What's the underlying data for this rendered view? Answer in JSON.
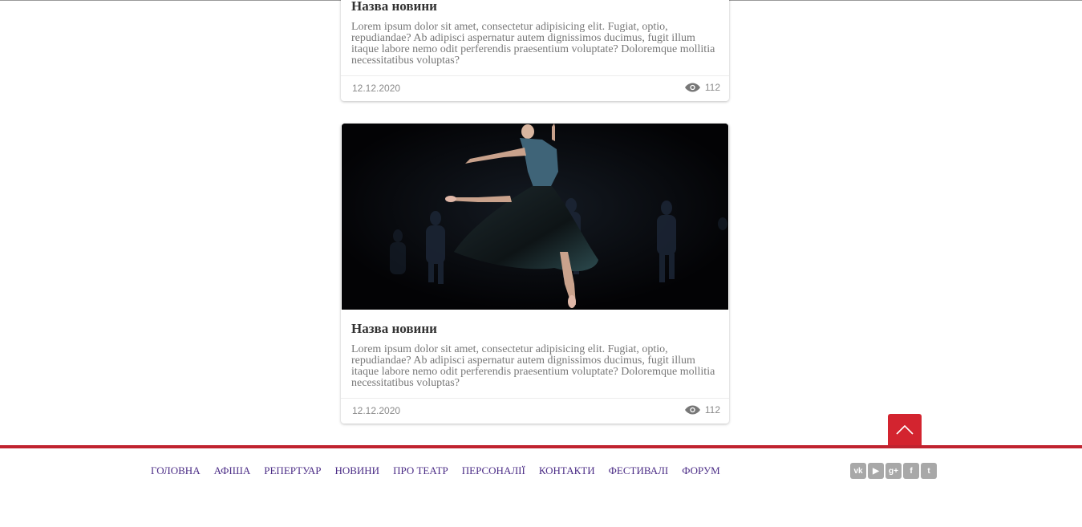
{
  "news": [
    {
      "title": "Назва новини",
      "text_lines": [
        "Lorem ipsum dolor sit amet, consectetur adipisicing elit. Fugiat, optio,",
        "repudiandae? Ab adipisci aspernatur autem dignissimos ducimus, fugit illum",
        "itaque labore nemo odit perferendis praesentium voluptate? Doloremque mollitia",
        "necessitatibus voluptas?"
      ],
      "date": "12.12.2020",
      "views": "112"
    },
    {
      "title": "Назва новини",
      "text_lines": [
        "Lorem ipsum dolor sit amet, consectetur adipisicing elit. Fugiat, optio,",
        "repudiandae? Ab adipisci aspernatur autem dignissimos ducimus, fugit illum",
        "itaque labore nemo odit perferendis praesentium voluptate? Doloremque mollitia",
        "necessitatibus voluptas?"
      ],
      "date": "12.12.2020",
      "views": "112"
    }
  ],
  "footer": {
    "nav": [
      "ГОЛОВНА",
      "АФІША",
      "РЕПЕРТУАР",
      "НОВИНИ",
      "ПРО ТЕАТР",
      "ПЕРСОНАЛІЇ",
      "КОНТАКТИ",
      "ФЕСТИВАЛІ",
      "ФОРУМ"
    ],
    "social": [
      {
        "icon": "vk-icon",
        "glyph": "vk"
      },
      {
        "icon": "youtube-icon",
        "glyph": "▶"
      },
      {
        "icon": "google-plus-icon",
        "glyph": "g+"
      },
      {
        "icon": "facebook-icon",
        "glyph": "f"
      },
      {
        "icon": "twitter-icon",
        "glyph": "t"
      }
    ]
  },
  "colors": {
    "accent": "#c0232f",
    "nav_link": "#4b2c86",
    "social_bg": "#a8a8a8"
  }
}
